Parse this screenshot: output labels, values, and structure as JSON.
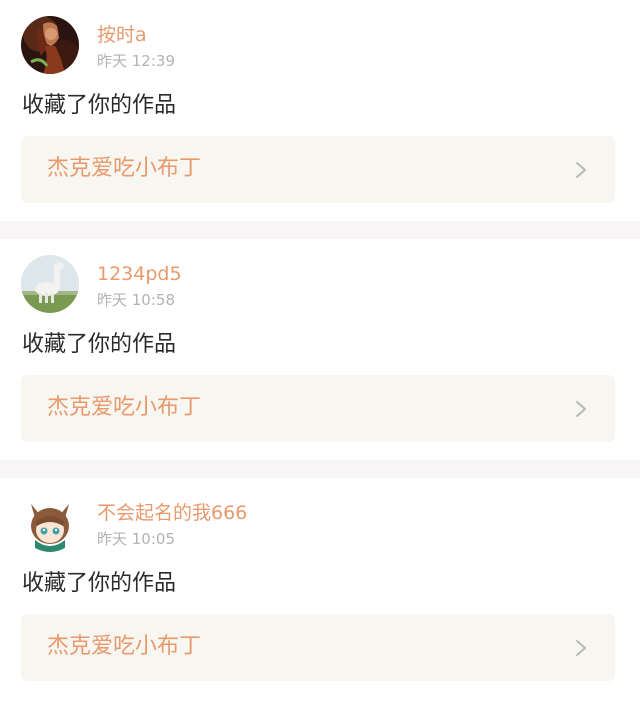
{
  "notifications": [
    {
      "username": "按时a",
      "time": "昨天 12:39",
      "action": "收藏了你的作品",
      "work_title": "杰克爱吃小布丁",
      "avatar": "fantasy-warrior-avatar"
    },
    {
      "username": "1234pd5",
      "time": "昨天 10:58",
      "action": "收藏了你的作品",
      "work_title": "杰克爱吃小布丁",
      "avatar": "alpaca-avatar"
    },
    {
      "username": "不会起名的我666",
      "time": "昨天 10:05",
      "action": "收藏了你的作品",
      "work_title": "杰克爱吃小布丁",
      "avatar": "anime-cat-girl-avatar"
    }
  ],
  "colors": {
    "accent": "#e89a6c",
    "muted": "#b3b3b3",
    "text": "#2b2b2b",
    "card_bg": "#f7f6f1",
    "divider": "#f7f5f5"
  }
}
